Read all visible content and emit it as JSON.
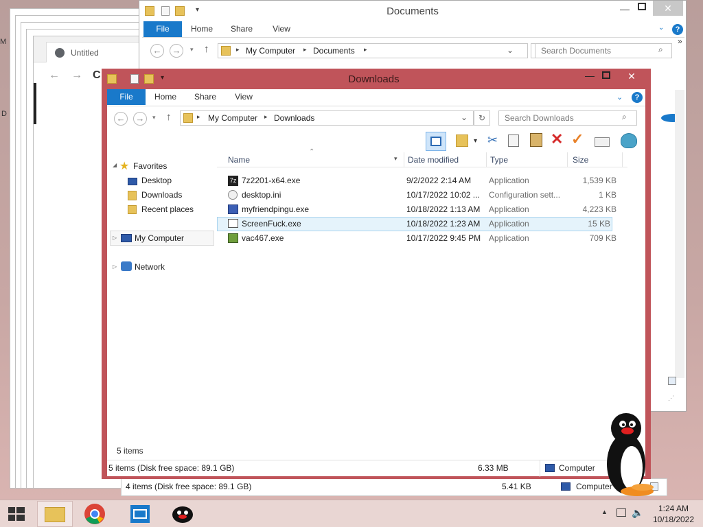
{
  "background_browser": {
    "tab_title": "Untitled"
  },
  "documents_window": {
    "title": "Documents",
    "tabs": [
      "File",
      "Home",
      "Share",
      "View"
    ],
    "breadcrumb": [
      "My Computer",
      "Documents"
    ],
    "search_placeholder": "Search Documents",
    "status_items": "4 items (Disk free space: 89.1 GB)",
    "status_size": "5.41 KB",
    "status_location": "Computer"
  },
  "downloads_window": {
    "title": "Downloads",
    "tabs": [
      "File",
      "Home",
      "Share",
      "View"
    ],
    "breadcrumb": [
      "My Computer",
      "Downloads"
    ],
    "search_placeholder": "Search Downloads",
    "columns": {
      "name": "Name",
      "date": "Date modified",
      "type": "Type",
      "size": "Size"
    },
    "nav": {
      "favorites": "Favorites",
      "desktop": "Desktop",
      "downloads": "Downloads",
      "recent": "Recent places",
      "computer": "My Computer",
      "network": "Network"
    },
    "files": [
      {
        "name": "7z2201-x64.exe",
        "date": "9/2/2022 2:14 AM",
        "type": "Application",
        "size": "1,539 KB",
        "icon": "7zip-icon"
      },
      {
        "name": "desktop.ini",
        "date": "10/17/2022 10:02 ...",
        "type": "Configuration sett...",
        "size": "1 KB",
        "icon": "settings-file-icon"
      },
      {
        "name": "myfriendpingu.exe",
        "date": "10/18/2022 1:13 AM",
        "type": "Application",
        "size": "4,223 KB",
        "icon": "app-icon"
      },
      {
        "name": "ScreenFuck.exe",
        "date": "10/18/2022 1:23 AM",
        "type": "Application",
        "size": "15 KB",
        "icon": "window-app-icon",
        "selected": true
      },
      {
        "name": "vac467.exe",
        "date": "10/17/2022 9:45 PM",
        "type": "Application",
        "size": "709 KB",
        "icon": "app-icon"
      }
    ],
    "items_count": "5 items",
    "status_items": "5 items (Disk free space: 89.1 GB)",
    "status_size": "6.33 MB",
    "status_location": "Computer",
    "frame_color": "#c0545a"
  },
  "taskbar": {
    "time": "1:24 AM",
    "date": "10/18/2022",
    "apps": [
      "start-button",
      "file-explorer-icon",
      "chrome-icon",
      "mail-icon",
      "pingu-icon"
    ]
  },
  "colors": {
    "accent": "#1979ca",
    "selection": "#cce8ff",
    "taskbar": "#e9d6d3"
  }
}
